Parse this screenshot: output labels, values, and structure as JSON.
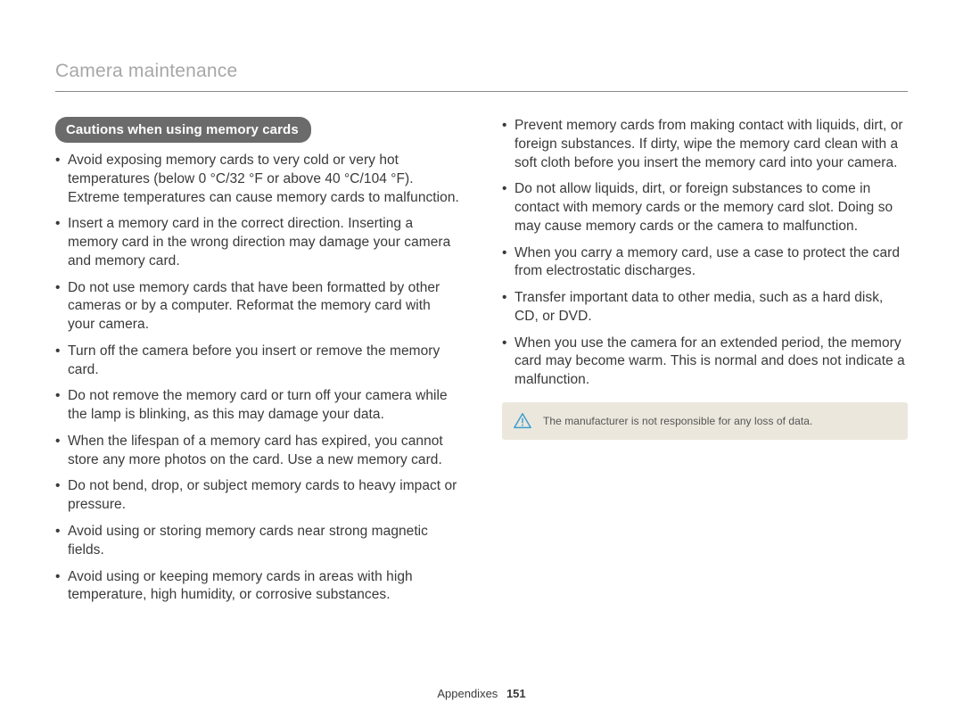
{
  "header": {
    "title": "Camera maintenance"
  },
  "section": {
    "pill": "Cautions when using memory cards"
  },
  "leftItems": [
    "Avoid exposing memory cards to very cold or very hot temperatures (below 0 °C/32 °F or above 40 °C/104 °F). Extreme temperatures can cause memory cards to malfunction.",
    "Insert a memory card in the correct direction. Inserting a memory card in the wrong direction may damage your camera and memory card.",
    "Do not use memory cards that have been formatted by other cameras or by a computer. Reformat the memory card with your camera.",
    "Turn off the camera before you insert or remove the memory card.",
    "Do not remove the memory card or turn off your camera while the lamp is blinking, as this may damage your data.",
    "When the lifespan of a memory card has expired, you cannot store any more photos on the card. Use a new memory card.",
    "Do not bend, drop, or subject memory cards to heavy impact or pressure.",
    "Avoid using or storing memory cards near strong magnetic fields.",
    "Avoid using or keeping memory cards in areas with high temperature, high humidity, or corrosive substances."
  ],
  "rightItems": [
    "Prevent memory cards from making contact with liquids, dirt, or foreign substances. If dirty, wipe the memory card clean with a soft cloth before you insert the memory card into your camera.",
    "Do not allow liquids, dirt, or foreign substances to come in contact with memory cards or the memory card slot. Doing so may cause memory cards or the camera to malfunction.",
    "When you carry a memory card, use a case to protect the card from electrostatic discharges.",
    "Transfer important data to other media, such as a hard disk, CD, or DVD.",
    "When you use the camera for an extended period, the memory card may become warm. This is normal and does not indicate a malfunction."
  ],
  "callout": {
    "text": "The manufacturer is not responsible for any loss of data."
  },
  "footer": {
    "label": "Appendixes",
    "page": "151"
  }
}
